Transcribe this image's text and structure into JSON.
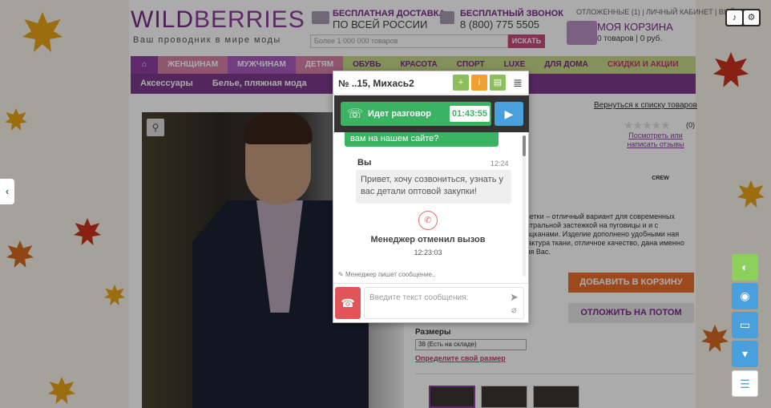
{
  "site": {
    "logo_a": "WILD",
    "logo_b": "BERRIES",
    "slogan": "Ваш проводник в мире моды",
    "delivery_1": "БЕСПЛАТНАЯ ДОСТАВКА",
    "delivery_2": "ПО ВСЕЙ РОССИИ",
    "call_1": "БЕСПЛАТНЫЙ ЗВОНОК",
    "call_2": "8 (800) 775 5505",
    "toplinks": "ОТЛОЖЕННЫЕ (1) | ЛИЧНЫЙ КАБИНЕТ | ВЫЙТИ",
    "search_placeholder": "Более 1 000 000 товаров",
    "search_button": "ИСКАТЬ",
    "basket_title": "МОЯ КОРЗИНА",
    "basket_sub": "0 товаров | 0 руб."
  },
  "nav": {
    "home_icon": "house-icon",
    "items": [
      "ЖЕНЩИНАМ",
      "МУЖЧИНАМ",
      "ДЕТЯМ",
      "ОБУВЬ",
      "КРАСОТА",
      "СПОРТ",
      "LUXE",
      "ДЛЯ ДОМА",
      "СКИДКИ И АКЦИИ"
    ],
    "sub": [
      "Аксессуары",
      "Белье, пляжная мода"
    ]
  },
  "product": {
    "back_link": "Вернуться к списку товаров",
    "stars": "★★★★★",
    "rating_count": "(0)",
    "review_link": "Посмотреть или написать отзывы",
    "brand": "CREW",
    "desc": "цветки – отличный вариант для современных ентральной застежкой на пуговицы и и с лацканами. Изделие дополнено удобными ная фактура ткани, отличное качество, дана именно для Вас.",
    "add_btn": "ДОБАВИТЬ В КОРЗИНУ",
    "later_btn": "ОТЛОЖИТЬ НА ПОТОМ",
    "sizes_label": "Размеры",
    "size_selected": "38 (Есть на складе)",
    "size_link": "Определите свой размер"
  },
  "chat": {
    "title": "№ ..15, Михась2",
    "call_status": "Идет разговор",
    "call_timer": "01:43:55",
    "prev_message": "вам на нашем сайте?",
    "you_label": "Вы",
    "you_time": "12:24",
    "you_message": "Привет, хочу созвониться, узнать у вас детали оптовой закупки!",
    "missed_label": "Менеджер отменил вызов",
    "missed_time": "12:23:03",
    "typing": "Менеджер пишет сообщение..",
    "input_placeholder": "Введите текст сообщения:"
  },
  "colors": {
    "brand_purple": "#7b2a8a",
    "call_green": "#3cb263",
    "hangup_red": "#e0545a",
    "video_blue": "#4aa0dc"
  }
}
